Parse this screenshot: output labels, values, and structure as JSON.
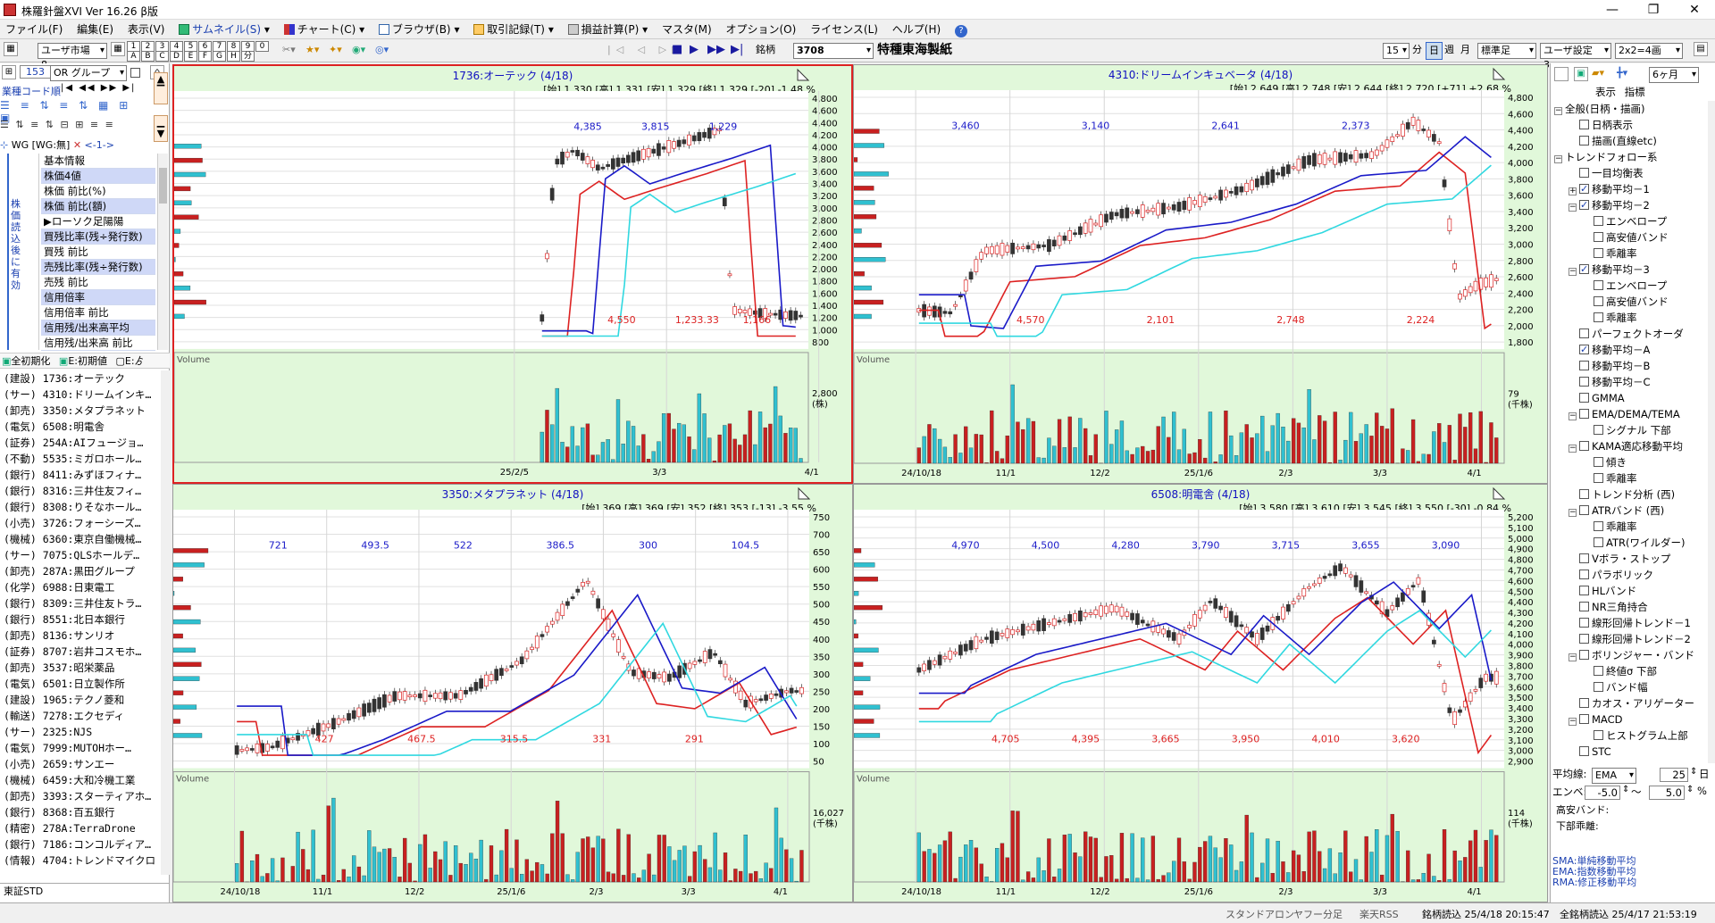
{
  "window": {
    "title": "株羅針盤XVI Ver 16.26 β版"
  },
  "menu": [
    {
      "label": "ファイル(F)"
    },
    {
      "label": "編集(E)"
    },
    {
      "label": "表示(V)"
    },
    {
      "label": "サムネイル(S)",
      "icon": "thumbnail-icon"
    },
    {
      "label": "チャート(C)",
      "icon": "chart-icon"
    },
    {
      "label": "ブラウザ(B)",
      "icon": "browser-icon"
    },
    {
      "label": "取引記録(T)",
      "icon": "trade-icon"
    },
    {
      "label": "損益計算(P)",
      "icon": "calc-icon"
    },
    {
      "label": "マスタ(M)"
    },
    {
      "label": "オプション(O)"
    },
    {
      "label": "ライセンス(L)"
    },
    {
      "label": "ヘルプ(H)"
    }
  ],
  "toolbar": {
    "market_select": "ユーザ市場8",
    "digits_top": [
      "1",
      "2",
      "3",
      "4",
      "5",
      "6",
      "7",
      "8",
      "9",
      "0"
    ],
    "digits_bottom": [
      "A",
      "B",
      "C",
      "D",
      "E",
      "F",
      "G",
      "H",
      "分"
    ],
    "code_label": "銘柄",
    "code_value": "3708",
    "company": "特種東海製紙",
    "interval_select": "15",
    "interval_unit": "分",
    "period_buttons": [
      "日",
      "週",
      "月"
    ],
    "std_select": "標準足",
    "user_setting": "ユーザ設定3",
    "layout_select": "2x2=4画"
  },
  "left": {
    "count": "153",
    "group_select": "OR グループ",
    "sort_label": "業種コード順",
    "nav": [
      "|◀",
      "◀◀",
      "▶▶",
      "▶|"
    ],
    "wg_label": "WG",
    "wg_value": "[WG:無]",
    "arrow_label": "<-1->",
    "vertical_note": "株価読込後に有効",
    "indicators": [
      "基本情報",
      "株価4値",
      "株価 前比(%)",
      "株価 前比(額)",
      "▶ローソク足陽陽",
      "買残比率(残÷発行数)",
      "買残 前比",
      "売残比率(残÷発行数)",
      "売残 前比",
      "信用倍率",
      "信用倍率 前比",
      "信用残/出来高平均",
      "信用残/出来高 前比"
    ],
    "init_buttons": [
      "全初期化",
      "E:初期値",
      "E:ゟ"
    ],
    "stocks": [
      "(建設) 1736:オーテック",
      "(サー) 4310:ドリームインキ…",
      "(卸売) 3350:メタプラネット",
      "(電気) 6508:明電舎",
      "(証券) 254A:AIフュージョ…",
      "(不動) 5535:ミガロホール…",
      "(銀行) 8411:みずほフィナ…",
      "(銀行) 8316:三井住友フィ…",
      "(銀行) 8308:りそなホール…",
      "(小売) 3726:フォーシーズ…",
      "(機械) 6360:東京自働機械…",
      "(サー) 7075:QLSホールデ…",
      "(卸売) 287A:黒田グループ",
      "(化学) 6988:日東電工",
      "(銀行) 8309:三井住友トラ…",
      "(銀行) 8551:北日本銀行",
      "(卸売) 8136:サンリオ",
      "(証券) 8707:岩井コスモホ…",
      "(卸売) 3537:昭栄薬品",
      "(電気) 6501:日立製作所",
      "(建設) 1965:テクノ菱和",
      "(輸送) 7278:エクセディ",
      "(サー) 2325:NJS",
      "(電気) 7999:MUTOHホー…",
      "(小売) 2659:サンエー",
      "(機械) 6459:大和冷機工業",
      "(卸売) 3393:スターティアホ…",
      "(銀行) 8368:百五銀行",
      "(精密) 278A:TerraDrone",
      "(銀行) 7186:コンコルディア…",
      "(情報) 4704:トレンドマイクロ"
    ],
    "market_label": "東証STD"
  },
  "charts": [
    {
      "title": "1736:オーテック (4/18)",
      "info": "[始] 1,330 [高] 1,331 [安] 1,329 [終] 1,329 [-20] -1.48 %",
      "yticks": [
        "4,800",
        "4,600",
        "4,400",
        "4,200",
        "4,000",
        "3,800",
        "3,600",
        "3,400",
        "3,200",
        "3,000",
        "2,800",
        "2,600",
        "2,400",
        "2,200",
        "2,000",
        "1,800",
        "1,600",
        "1,400",
        "1,200",
        "1,000",
        "800"
      ],
      "xticks": [
        "25/2/5",
        "3/3",
        "4/1"
      ],
      "labels": [
        "4,385",
        "4,550",
        "3,815",
        "1,233.33",
        "1,229",
        "1,166"
      ],
      "vol_label": "Volume",
      "vol_axis": "2,800",
      "vol_unit": "(株)"
    },
    {
      "title": "4310:ドリームインキュベータ (4/18)",
      "info": "[始] 2,649 [高] 2,748 [安] 2,644 [終] 2,720 [+71] +2.68 %",
      "yticks": [
        "4,800",
        "4,600",
        "4,400",
        "4,200",
        "4,000",
        "3,800",
        "3,600",
        "3,400",
        "3,200",
        "3,000",
        "2,800",
        "2,600",
        "2,400",
        "2,200",
        "2,000",
        "1,800"
      ],
      "xticks": [
        "24/10/18",
        "11/1",
        "12/2",
        "25/1/6",
        "2/3",
        "3/3",
        "4/1"
      ],
      "labels": [
        "3,460",
        "4,570",
        "3,140",
        "2,101",
        "2,641",
        "2,748",
        "2,373",
        "2,224"
      ],
      "vol_label": "Volume",
      "vol_axis": "79",
      "vol_unit": "(千株)"
    },
    {
      "title": "3350:メタプラネット (4/18)",
      "info": "[始] 369 [高] 369 [安] 352 [終] 353 [-13] -3.55 %",
      "yticks": [
        "750",
        "700",
        "650",
        "600",
        "550",
        "500",
        "450",
        "400",
        "350",
        "300",
        "250",
        "200",
        "150",
        "100",
        "50"
      ],
      "xticks": [
        "24/10/18",
        "11/1",
        "12/2",
        "25/1/6",
        "2/3",
        "3/3",
        "4/1"
      ],
      "labels": [
        "721",
        "427",
        "493.5",
        "467.5",
        "522",
        "315.5",
        "386.5",
        "331",
        "300",
        "291",
        "104.5"
      ],
      "vol_label": "Volume",
      "vol_axis": "16,027",
      "vol_unit": "(千株)"
    },
    {
      "title": "6508:明電舎 (4/18)",
      "info": "[始] 3,580 [高] 3,610 [安] 3,545 [終] 3,550 [-30] -0.84 %",
      "yticks": [
        "5,200",
        "5,100",
        "5,000",
        "4,900",
        "4,800",
        "4,700",
        "4,600",
        "4,500",
        "4,400",
        "4,300",
        "4,200",
        "4,100",
        "4,000",
        "3,900",
        "3,800",
        "3,700",
        "3,600",
        "3,500",
        "3,400",
        "3,300",
        "3,200",
        "3,100",
        "3,000",
        "2,900"
      ],
      "xticks": [
        "24/10/18",
        "11/1",
        "12/2",
        "25/1/6",
        "2/3",
        "3/3",
        "4/1"
      ],
      "labels": [
        "4,970",
        "4,705",
        "4,500",
        "4,395",
        "4,280",
        "3,665",
        "3,790",
        "3,950",
        "3,715",
        "4,010",
        "3,655",
        "3,620",
        "3,090"
      ],
      "vol_label": "Volume",
      "vol_axis": "114",
      "vol_unit": "(千株)"
    }
  ],
  "right": {
    "period_select": "6ヶ月",
    "tabs": [
      "表示",
      "指標"
    ],
    "tree": [
      {
        "label": "全般(日柄・描画)",
        "exp": "−",
        "level": 0,
        "cb": false
      },
      {
        "label": "日柄表示",
        "level": 1,
        "cb": true,
        "on": false
      },
      {
        "label": "描画(直線etc)",
        "level": 1,
        "cb": true,
        "on": false
      },
      {
        "label": "トレンドフォロー系",
        "exp": "−",
        "level": 0,
        "cb": false
      },
      {
        "label": "一目均衡表",
        "level": 1,
        "cb": true,
        "on": false
      },
      {
        "label": "移動平均－1",
        "level": 1,
        "cb": true,
        "on": true,
        "exp": "+"
      },
      {
        "label": "移動平均－2",
        "level": 1,
        "cb": true,
        "on": true,
        "exp": "−"
      },
      {
        "label": "エンベロープ",
        "level": 2,
        "cb": true,
        "on": false
      },
      {
        "label": "高安値バンド",
        "level": 2,
        "cb": true,
        "on": false
      },
      {
        "label": "乖離率",
        "level": 2,
        "cb": true,
        "on": false
      },
      {
        "label": "移動平均－3",
        "level": 1,
        "cb": true,
        "on": true,
        "exp": "−"
      },
      {
        "label": "エンベロープ",
        "level": 2,
        "cb": true,
        "on": false
      },
      {
        "label": "高安値バンド",
        "level": 2,
        "cb": true,
        "on": false
      },
      {
        "label": "乖離率",
        "level": 2,
        "cb": true,
        "on": false
      },
      {
        "label": "パーフェクトオーダ",
        "level": 1,
        "cb": true,
        "on": false
      },
      {
        "label": "移動平均－A",
        "level": 1,
        "cb": true,
        "on": true
      },
      {
        "label": "移動平均－B",
        "level": 1,
        "cb": true,
        "on": false
      },
      {
        "label": "移動平均－C",
        "level": 1,
        "cb": true,
        "on": false
      },
      {
        "label": "GMMA",
        "level": 1,
        "cb": true,
        "on": false
      },
      {
        "label": "EMA/DEMA/TEMA",
        "level": 1,
        "cb": true,
        "on": false,
        "exp": "−"
      },
      {
        "label": "シグナル 下部",
        "level": 2,
        "cb": true,
        "on": false
      },
      {
        "label": "KAMA適応移動平均",
        "level": 1,
        "cb": true,
        "on": false,
        "exp": "−"
      },
      {
        "label": "傾き",
        "level": 2,
        "cb": true,
        "on": false
      },
      {
        "label": "乖離率",
        "level": 2,
        "cb": true,
        "on": false
      },
      {
        "label": "トレンド分析 (西)",
        "level": 1,
        "cb": true,
        "on": false
      },
      {
        "label": "ATRバンド (西)",
        "level": 1,
        "cb": true,
        "on": false,
        "exp": "−"
      },
      {
        "label": "乖離率",
        "level": 2,
        "cb": true,
        "on": false
      },
      {
        "label": "ATR(ワイルダー)",
        "level": 2,
        "cb": true,
        "on": false
      },
      {
        "label": "Vボラ・ストップ",
        "level": 1,
        "cb": true,
        "on": false
      },
      {
        "label": "パラボリック",
        "level": 1,
        "cb": true,
        "on": false
      },
      {
        "label": "HLバンド",
        "level": 1,
        "cb": true,
        "on": false
      },
      {
        "label": "NR三角持合",
        "level": 1,
        "cb": true,
        "on": false
      },
      {
        "label": "線形回帰トレンド－1",
        "level": 1,
        "cb": true,
        "on": false
      },
      {
        "label": "線形回帰トレンド－2",
        "level": 1,
        "cb": true,
        "on": false
      },
      {
        "label": "ボリンジャー・バンド",
        "level": 1,
        "cb": true,
        "on": false,
        "exp": "−"
      },
      {
        "label": "終値σ 下部",
        "level": 2,
        "cb": true,
        "on": false
      },
      {
        "label": "バンド幅",
        "level": 2,
        "cb": true,
        "on": false
      },
      {
        "label": "カオス・アリゲーター",
        "level": 1,
        "cb": true,
        "on": false
      },
      {
        "label": "MACD",
        "level": 1,
        "cb": true,
        "on": false,
        "exp": "−"
      },
      {
        "label": "ヒストグラム上部",
        "level": 2,
        "cb": true,
        "on": false
      },
      {
        "label": "STC",
        "level": 1,
        "cb": true,
        "on": false
      }
    ],
    "ma_label": "平均線:",
    "ma_type": "EMA",
    "ma_period": "25",
    "ma_unit": "日",
    "env_label": "エンベ:",
    "env_low": "-5.0",
    "env_sep": "〜",
    "env_high": "5.0",
    "env_unit": "%",
    "band_high": "高安バンド:",
    "band_low": "下部乖離:",
    "legend": [
      "SMA:単純移動平均",
      "EMA:指数移動平均",
      "RMA:修正移動平均"
    ]
  },
  "status": {
    "items": [
      "スタンドアロン",
      "ヤフー分足",
      "楽天RSS"
    ],
    "read1": "銘柄読込 25/4/18 20:15:47",
    "read2": "全銘柄読込 25/4/17 21:53:19"
  }
}
